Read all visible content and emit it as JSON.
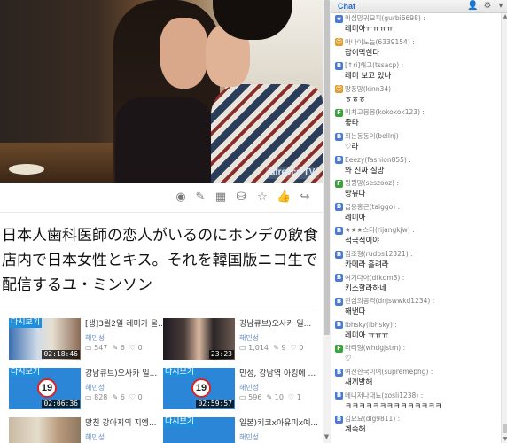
{
  "video": {
    "logo": "afreeca TV"
  },
  "toolbar": {
    "icons": [
      "location-pin-icon",
      "edit-icon",
      "gift-icon",
      "cart-icon",
      "star-icon",
      "thumbs-up-icon",
      "share-icon"
    ]
  },
  "title_lines": [
    "日本人歯科医師の恋人がいるのにホンデの飲食",
    "店内で日本女性とキス。それを韓国版ニコ生で",
    "配信するユ・ミンソン"
  ],
  "cards": [
    {
      "tag": "다시보기",
      "duration": "02:18:46",
      "title": "[생]3월2일 레미가 울...",
      "user": "해민성",
      "views": "547",
      "comments": "6",
      "likes": "0"
    },
    {
      "tag": "",
      "duration": "23:23",
      "title": "강남큐브)오사카 일...",
      "user": "해민성",
      "views": "1,014",
      "comments": "9",
      "likes": "0"
    },
    {
      "tag": "다시보기",
      "duration": "02:06:36",
      "title": "강남큐브)오사카 일...",
      "user": "해민성",
      "views": "828",
      "comments": "6",
      "likes": "0",
      "age": "19"
    },
    {
      "tag": "다시보기",
      "duration": "02:59:57",
      "title": "민성, 강남역 아킹에 ...",
      "user": "해민성",
      "views": "596",
      "comments": "10",
      "likes": "1",
      "age": "19"
    },
    {
      "tag": "",
      "duration": "",
      "title": "망친 강아지의 지엥...",
      "user": "해민성",
      "views": "",
      "comments": "",
      "likes": ""
    },
    {
      "tag": "다시보기",
      "duration": "",
      "title": "일본)키코x아유미x예...",
      "user": "해민성",
      "views": "",
      "comments": "",
      "likes": ""
    }
  ],
  "chat": {
    "title": "Chat",
    "messages": [
      {
        "user": "미섬망궈묘피(gurbi6698) :",
        "text": "레미아ㅠㅠㅠㅠ",
        "icon": "star-fan-icon",
        "color": "#4a7bd0"
      },
      {
        "user": "마나이노늡(6339154) :",
        "text": "잡이먹힌다",
        "icon": "smile-icon",
        "color": "#e39b2b"
      },
      {
        "user": "[↑ri]해그(tssacp) :",
        "text": "레미 보고 있나",
        "icon": "user-icon",
        "color": "#4a7bd0"
      },
      {
        "user": "망풍망(kinn34) :",
        "text": "ㅎㅎㅎ",
        "icon": "smile-icon",
        "color": "#e39b2b"
      },
      {
        "user": "미치고몽몽(kokokok123) :",
        "text": "좋타",
        "icon": "fan-icon",
        "color": "#3aa33a"
      },
      {
        "user": "회는동동이(bellnj) :",
        "text": "♡라",
        "icon": "user-icon",
        "color": "#4a7bd0"
      },
      {
        "user": "Eeezy(fashion855) :",
        "text": "와 진짜 실망",
        "icon": "user-icon",
        "color": "#4a7bd0"
      },
      {
        "user": "뮝뮝망(seszooz) :",
        "text": "망뮤다",
        "icon": "fan-icon",
        "color": "#3aa33a"
      },
      {
        "user": "급옹홍곤(taiggo) :",
        "text": "레미아",
        "icon": "user-icon",
        "color": "#4a7bd0"
      },
      {
        "user": "★★★스타(rijangkjw) :",
        "text": "적극적이야",
        "icon": "user-icon",
        "color": "#4a7bd0"
      },
      {
        "user": "김조형(rudbs12321) :",
        "text": "카메라 흘려라",
        "icon": "user-icon",
        "color": "#4a7bd0"
      },
      {
        "user": "여기다아(dtkdm3) :",
        "text": "키스할라하네",
        "icon": "user-icon",
        "color": "#4a7bd0"
      },
      {
        "user": "진심의공격(dnjswwkd1234) :",
        "text": "해낸다",
        "icon": "user-icon",
        "color": "#4a7bd0"
      },
      {
        "user": "lbhsky(lbhsky) :",
        "text": "레미아 ㅠㅠㅠ",
        "icon": "user-icon",
        "color": "#4a7bd0"
      },
      {
        "user": "라티형(whdgjstm) :",
        "text": "♡",
        "icon": "fan-icon",
        "color": "#3aa33a"
      },
      {
        "user": "여진한국이여(supremephg) :",
        "text": "새끼발해",
        "icon": "user-icon",
        "color": "#4a7bd0"
      },
      {
        "user": "메니저나대뇨(xosli1238) :",
        "text": "ㅋㅋㅋㅋㅋㅋㅋㅋㅋㅋㅋㅋㅋㅋ",
        "icon": "user-icon",
        "color": "#4a7bd0"
      },
      {
        "user": "김요묘(dlg9811) :",
        "text": "계속해",
        "icon": "user-icon",
        "color": "#4a7bd0"
      }
    ]
  }
}
